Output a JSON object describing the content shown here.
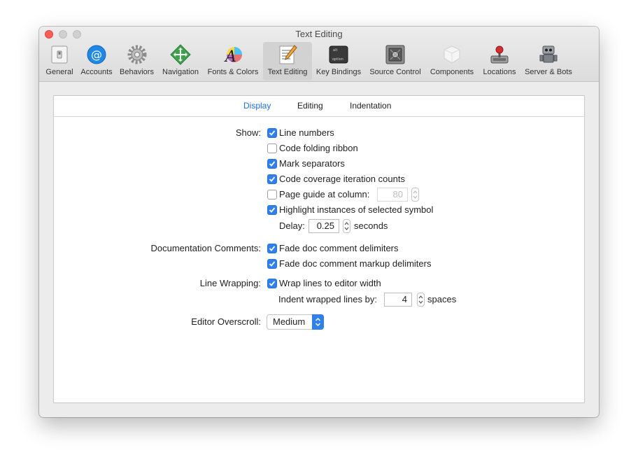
{
  "window": {
    "title": "Text Editing"
  },
  "toolbar": [
    {
      "label": "General",
      "icon": "general-icon"
    },
    {
      "label": "Accounts",
      "icon": "accounts-icon"
    },
    {
      "label": "Behaviors",
      "icon": "behaviors-icon"
    },
    {
      "label": "Navigation",
      "icon": "navigation-icon"
    },
    {
      "label": "Fonts & Colors",
      "icon": "fonts-colors-icon"
    },
    {
      "label": "Text Editing",
      "icon": "text-editing-icon",
      "selected": true
    },
    {
      "label": "Key Bindings",
      "icon": "key-bindings-icon"
    },
    {
      "label": "Source Control",
      "icon": "source-control-icon"
    },
    {
      "label": "Components",
      "icon": "components-icon"
    },
    {
      "label": "Locations",
      "icon": "locations-icon"
    },
    {
      "label": "Server & Bots",
      "icon": "server-bots-icon"
    }
  ],
  "tabs": [
    {
      "label": "Display",
      "active": true
    },
    {
      "label": "Editing",
      "active": false
    },
    {
      "label": "Indentation",
      "active": false
    }
  ],
  "show": {
    "label": "Show:",
    "options": [
      {
        "label": "Line numbers",
        "checked": true
      },
      {
        "label": "Code folding ribbon",
        "checked": false
      },
      {
        "label": "Mark separators",
        "checked": true
      },
      {
        "label": "Code coverage iteration counts",
        "checked": true
      },
      {
        "label": "Page guide at column:",
        "checked": false
      },
      {
        "label": "Highlight instances of selected symbol",
        "checked": true
      }
    ],
    "page_guide_value": "80",
    "delay_label": "Delay:",
    "delay_value": "0.25",
    "delay_unit": "seconds"
  },
  "doc_comments": {
    "label": "Documentation Comments:",
    "options": [
      {
        "label": "Fade doc comment delimiters",
        "checked": true
      },
      {
        "label": "Fade doc comment markup delimiters",
        "checked": true
      }
    ]
  },
  "line_wrapping": {
    "label": "Line Wrapping:",
    "option": {
      "label": "Wrap lines to editor width",
      "checked": true
    },
    "indent_label": "Indent wrapped lines by:",
    "indent_value": "4",
    "indent_unit": "spaces"
  },
  "overscroll": {
    "label": "Editor Overscroll:",
    "value": "Medium"
  },
  "colors": {
    "accent": "#2f80ed",
    "close": "#fe5f57"
  }
}
